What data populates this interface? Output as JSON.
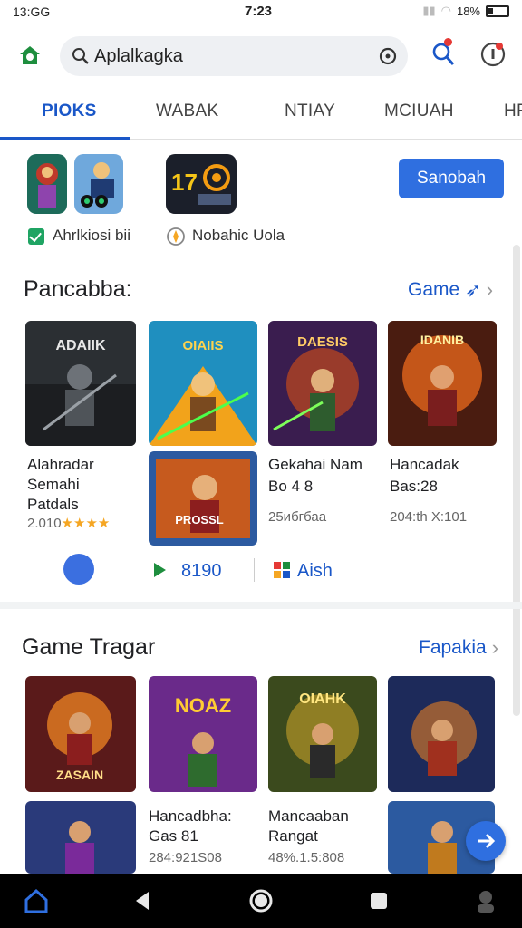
{
  "status": {
    "time_left": "13:GG",
    "time_center": "7:23",
    "battery": "18%"
  },
  "search": {
    "value": "Aplalkagka"
  },
  "tabs": [
    {
      "label": "PIOKS"
    },
    {
      "label": "WABAK"
    },
    {
      "label": "NTIAY"
    },
    {
      "label": "MCIUAH"
    },
    {
      "label": "HR"
    }
  ],
  "featured": {
    "item1_caption": "Ahrlkiosi bii",
    "item2_caption": "Nobahic Uola",
    "cta_label": "Sanobah"
  },
  "section1": {
    "title": "Pancabba:",
    "link": "Game",
    "games": [
      {
        "title": "Alahradar",
        "line2": "Semahi",
        "line3": "Patdals",
        "meta": "2.010",
        "stars": "★★★★"
      },
      {
        "title": "Gekahai Nam",
        "line2": "Bo 4 8",
        "meta": "25ибгбаа"
      },
      {
        "title": "Hancadak",
        "line2": "Bas:28",
        "meta": "204:th X:101"
      }
    ],
    "art_labels": [
      "ADAIIK",
      "OIAIIS",
      "DAESIS",
      "IDANIB",
      "PROSSL"
    ],
    "actions": {
      "play_label": "8190",
      "apps_label": "Aish"
    }
  },
  "section2": {
    "title": "Game Tragar",
    "link": "Fapakia",
    "art_labels": [
      "ZASAIN",
      "NOAZ",
      "OIAHK"
    ],
    "games": [
      {
        "title": "Hancadbha:",
        "line2": "Gas 81",
        "meta": "284:921S08"
      },
      {
        "title": "Mancaaban",
        "line2": "Rangat",
        "meta": "48%.1.5:808"
      }
    ]
  },
  "colors": {
    "accent": "#1a57c8",
    "button": "#2f6fe0",
    "star": "#f5a623"
  }
}
